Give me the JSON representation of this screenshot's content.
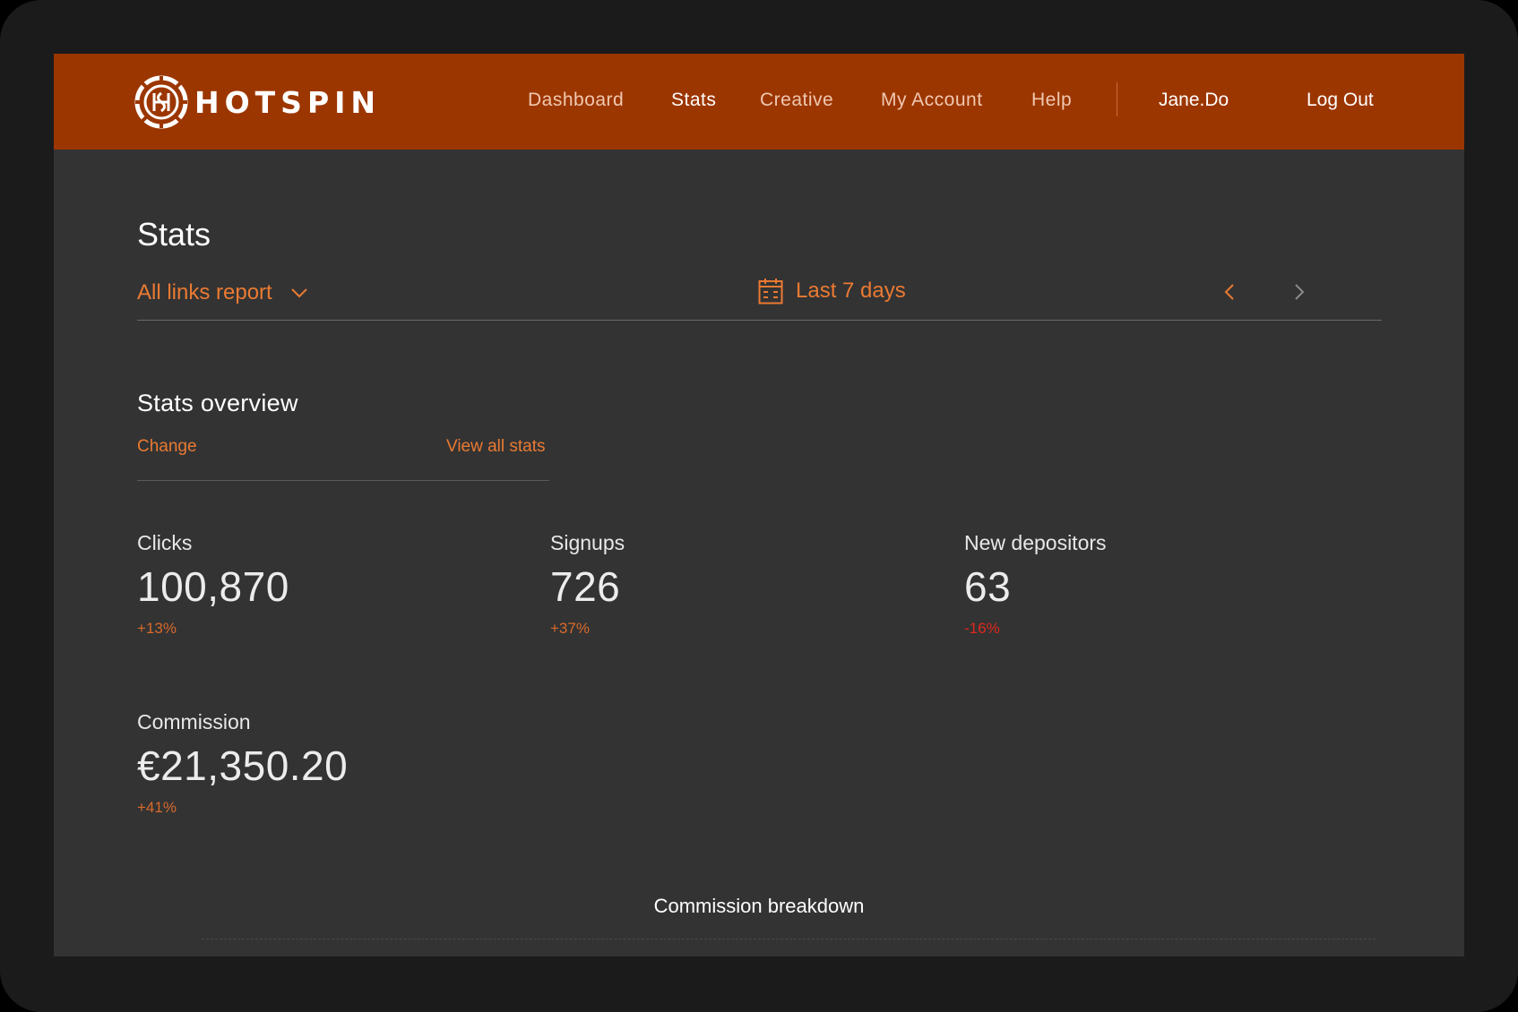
{
  "brand": {
    "name": "HOTSPIN",
    "header_color": "#9c3600",
    "accent_color": "#ea7a33",
    "negative_color": "#e0281e"
  },
  "nav": {
    "items": [
      {
        "label": "Dashboard",
        "active": false
      },
      {
        "label": "Stats",
        "active": true
      },
      {
        "label": "Creative",
        "active": false
      },
      {
        "label": "My Account",
        "active": false
      },
      {
        "label": "Help",
        "active": false
      }
    ],
    "user": "Jane.Do",
    "logout": "Log Out"
  },
  "page": {
    "title": "Stats"
  },
  "filters": {
    "report": "All links report",
    "date_range": "Last 7 days",
    "icons": {
      "report_dropdown": "chevron-down-icon",
      "calendar": "calendar-icon",
      "prev": "chevron-left-icon",
      "next": "chevron-right-icon"
    }
  },
  "overview": {
    "title": "Stats overview",
    "change_link": "Change",
    "view_all_link": "View all stats",
    "stats": [
      {
        "label": "Clicks",
        "value": "100,870",
        "change": "+13%",
        "trend": "up"
      },
      {
        "label": "Signups",
        "value": "726",
        "change": "+37%",
        "trend": "up"
      },
      {
        "label": "New depositors",
        "value": "63",
        "change": "-16%",
        "trend": "down"
      },
      {
        "label": "Commission",
        "value": "€21,350.20",
        "change": "+41%",
        "trend": "up"
      }
    ]
  },
  "breakdown": {
    "title": "Commission breakdown"
  }
}
